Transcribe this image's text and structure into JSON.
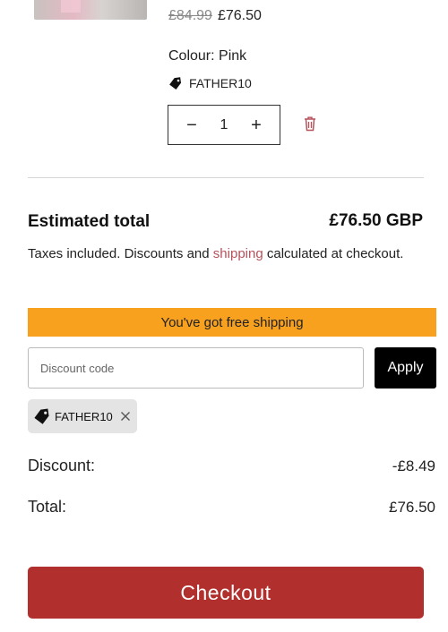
{
  "item": {
    "old_price": "£84.99",
    "new_price": "£76.50",
    "colour": "Colour: Pink",
    "discount_code": "FATHER10",
    "quantity": "1",
    "qty_minus": "−",
    "qty_plus": "+"
  },
  "summary": {
    "estimated_label": "Estimated total",
    "estimated_value": "£76.50 GBP",
    "tax_note_before": "Taxes included. Discounts and ",
    "tax_note_link": "shipping",
    "tax_note_after": " calculated at checkout."
  },
  "shipping_banner": {
    "text": "You've got free shipping",
    "color": "#f7a11f"
  },
  "discount": {
    "placeholder": "Discount code",
    "apply_label": "Apply",
    "applied_code": "FATHER10",
    "discount_label": "Discount:",
    "discount_value": "-£8.49",
    "total_label": "Total:",
    "total_value": "£76.50"
  },
  "checkout": {
    "label": "Checkout",
    "color": "#b1302d"
  },
  "icons": {
    "tag": "tag-icon",
    "trash": "trash-icon",
    "close": "close-icon"
  }
}
